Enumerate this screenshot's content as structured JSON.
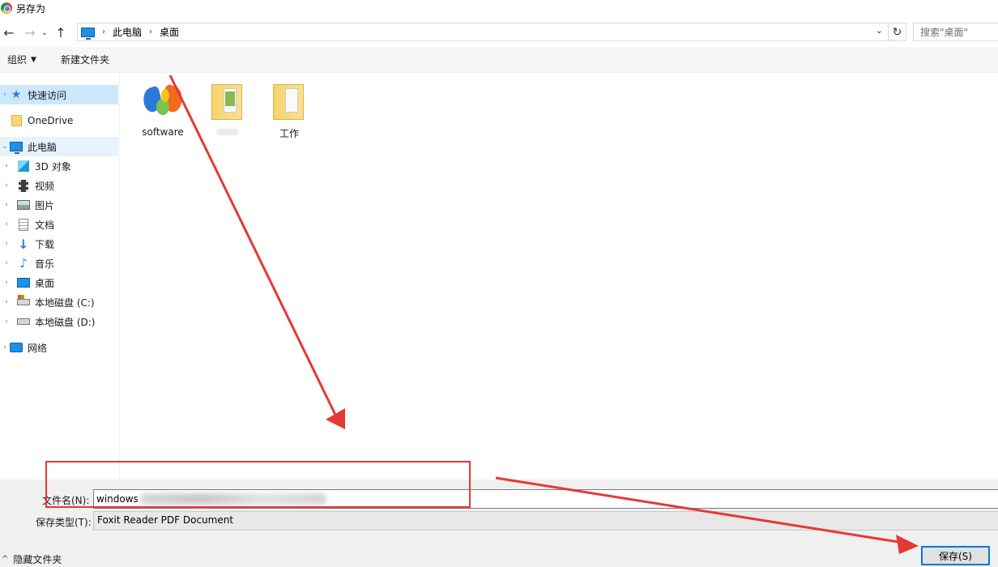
{
  "window": {
    "title": "另存为"
  },
  "address": {
    "crumbs": [
      "此电脑",
      "桌面"
    ],
    "separator": "›",
    "search_placeholder": "搜索\"桌面\""
  },
  "nav_buttons": {
    "back": "←",
    "forward": "→",
    "recent": "⌄",
    "up": "↑",
    "refresh": "↻",
    "dropdown": "⌄"
  },
  "toolbar": {
    "organize": "组织",
    "new_folder": "新建文件夹"
  },
  "nav_pane": {
    "items": [
      {
        "label": "快速访问",
        "icon": "star-icon"
      },
      {
        "label": "OneDrive",
        "icon": "folder-icon"
      },
      {
        "label": "此电脑",
        "icon": "computer-icon"
      },
      {
        "label": "3D 对象",
        "icon": "cube-icon"
      },
      {
        "label": "视频",
        "icon": "video-icon"
      },
      {
        "label": "图片",
        "icon": "picture-icon"
      },
      {
        "label": "文档",
        "icon": "document-icon"
      },
      {
        "label": "下载",
        "icon": "download-icon"
      },
      {
        "label": "音乐",
        "icon": "music-icon"
      },
      {
        "label": "桌面",
        "icon": "desktop-icon"
      },
      {
        "label": "本地磁盘 (C:)",
        "icon": "drive-c-icon"
      },
      {
        "label": "本地磁盘 (D:)",
        "icon": "drive-d-icon"
      },
      {
        "label": "网络",
        "icon": "network-icon"
      }
    ]
  },
  "files": [
    {
      "name": "software",
      "icon": "butterfly-logo-icon"
    },
    {
      "name": "",
      "icon": "folder-icon"
    },
    {
      "name": "工作",
      "icon": "folder-icon"
    }
  ],
  "bottom": {
    "filename_label": "文件名(N):",
    "filename_value": "windows",
    "filetype_label": "保存类型(T):",
    "filetype_value": "Foxit Reader PDF Document",
    "hide_folders": "隐藏文件夹",
    "save_button": "保存(S)"
  },
  "annotation": {
    "color": "#e53935"
  }
}
